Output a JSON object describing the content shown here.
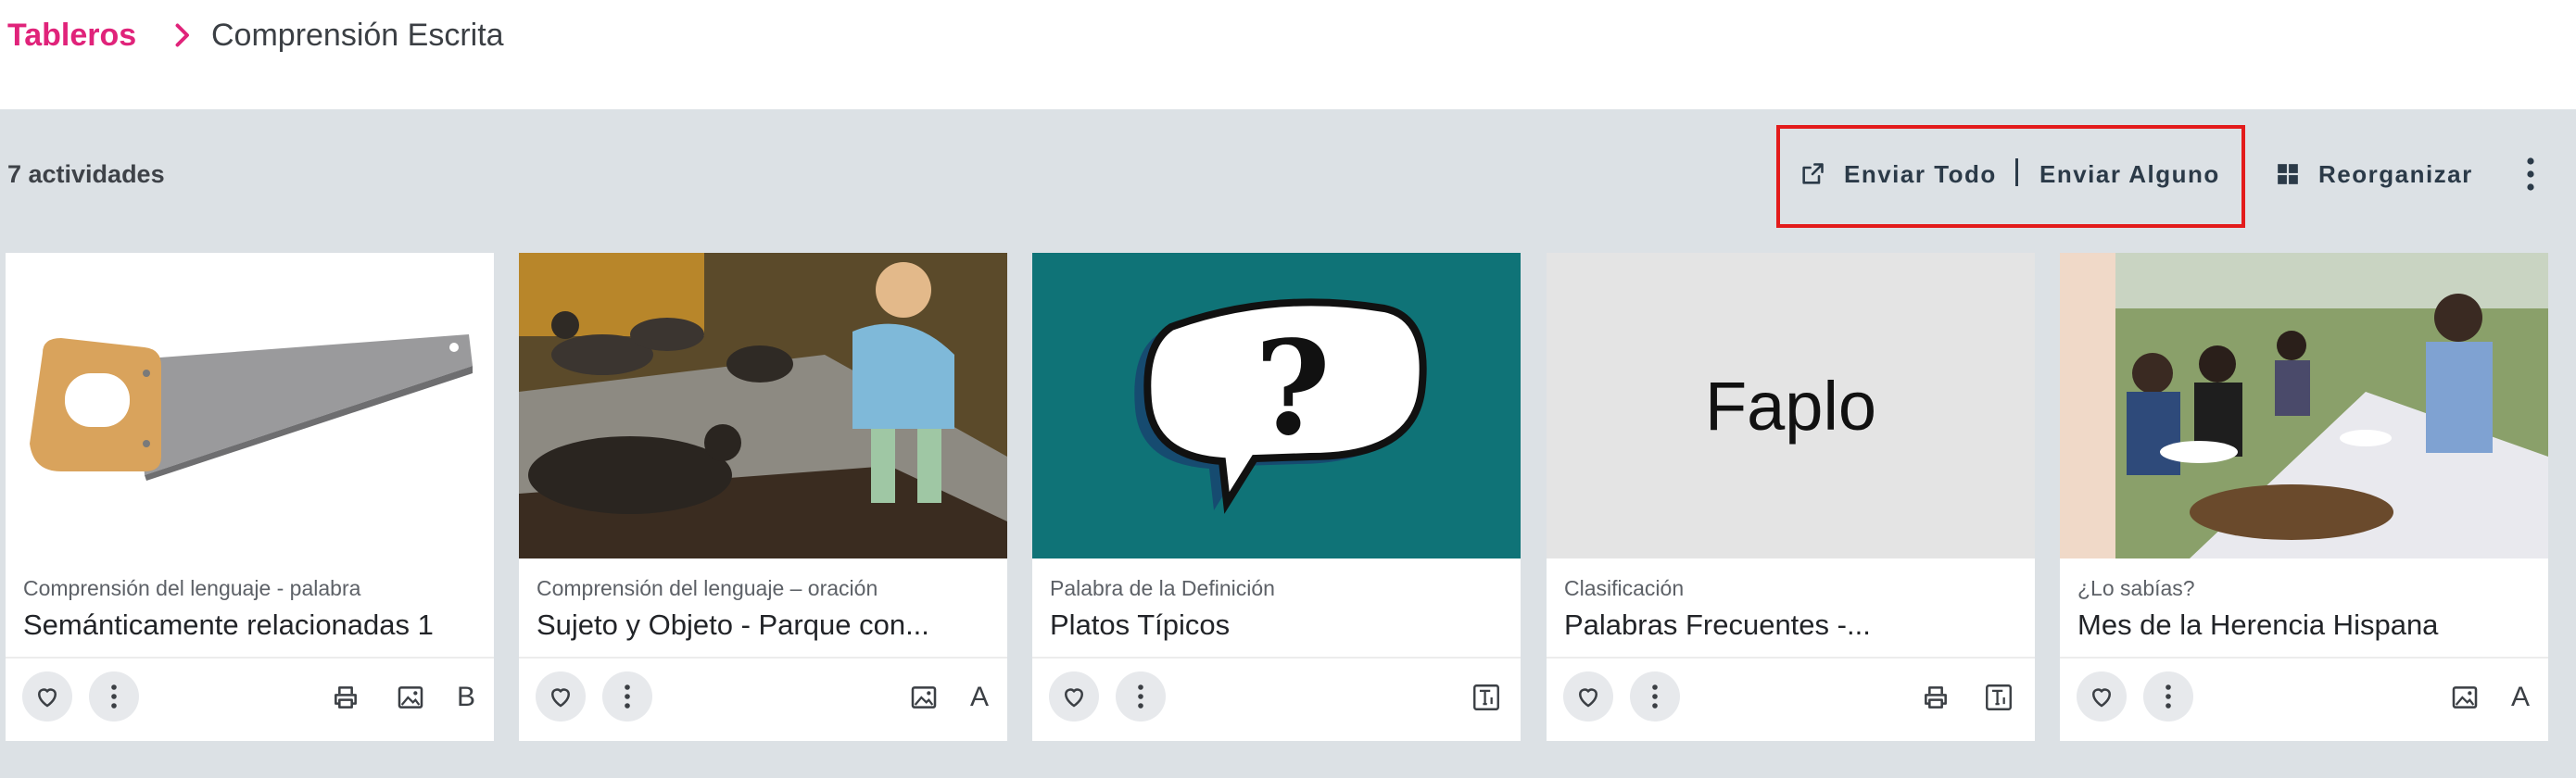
{
  "breadcrumb": {
    "parent": "Tableros",
    "current": "Comprensión Escrita"
  },
  "toolbar": {
    "count_label": "7 actividades",
    "send_all_label": "Enviar Todo",
    "send_some_label": "Enviar Alguno",
    "reorganize_label": "Reorganizar"
  },
  "cards": [
    {
      "category": "Comprensión del lenguaje - palabra",
      "title": "Semánticamente relacionadas 1",
      "letter": "B",
      "image": "saw"
    },
    {
      "category": "Comprensión del lenguaje – oración",
      "title": "Sujeto y Objeto - Parque con...",
      "letter": "A",
      "image": "ducks-girl"
    },
    {
      "category": "Palabra de la Definición",
      "title": "Platos Típicos",
      "image": "question-bubble"
    },
    {
      "category": "Clasificación",
      "title": "Palabras Frecuentes -...",
      "image_text": "Faplo"
    },
    {
      "category": "¿Lo sabías?",
      "title": "Mes de la Herencia Hispana",
      "letter": "A",
      "image": "family-dinner"
    }
  ],
  "colors": {
    "accent": "#e0237a",
    "highlight": "#e31b1b",
    "background": "#dce1e5"
  }
}
